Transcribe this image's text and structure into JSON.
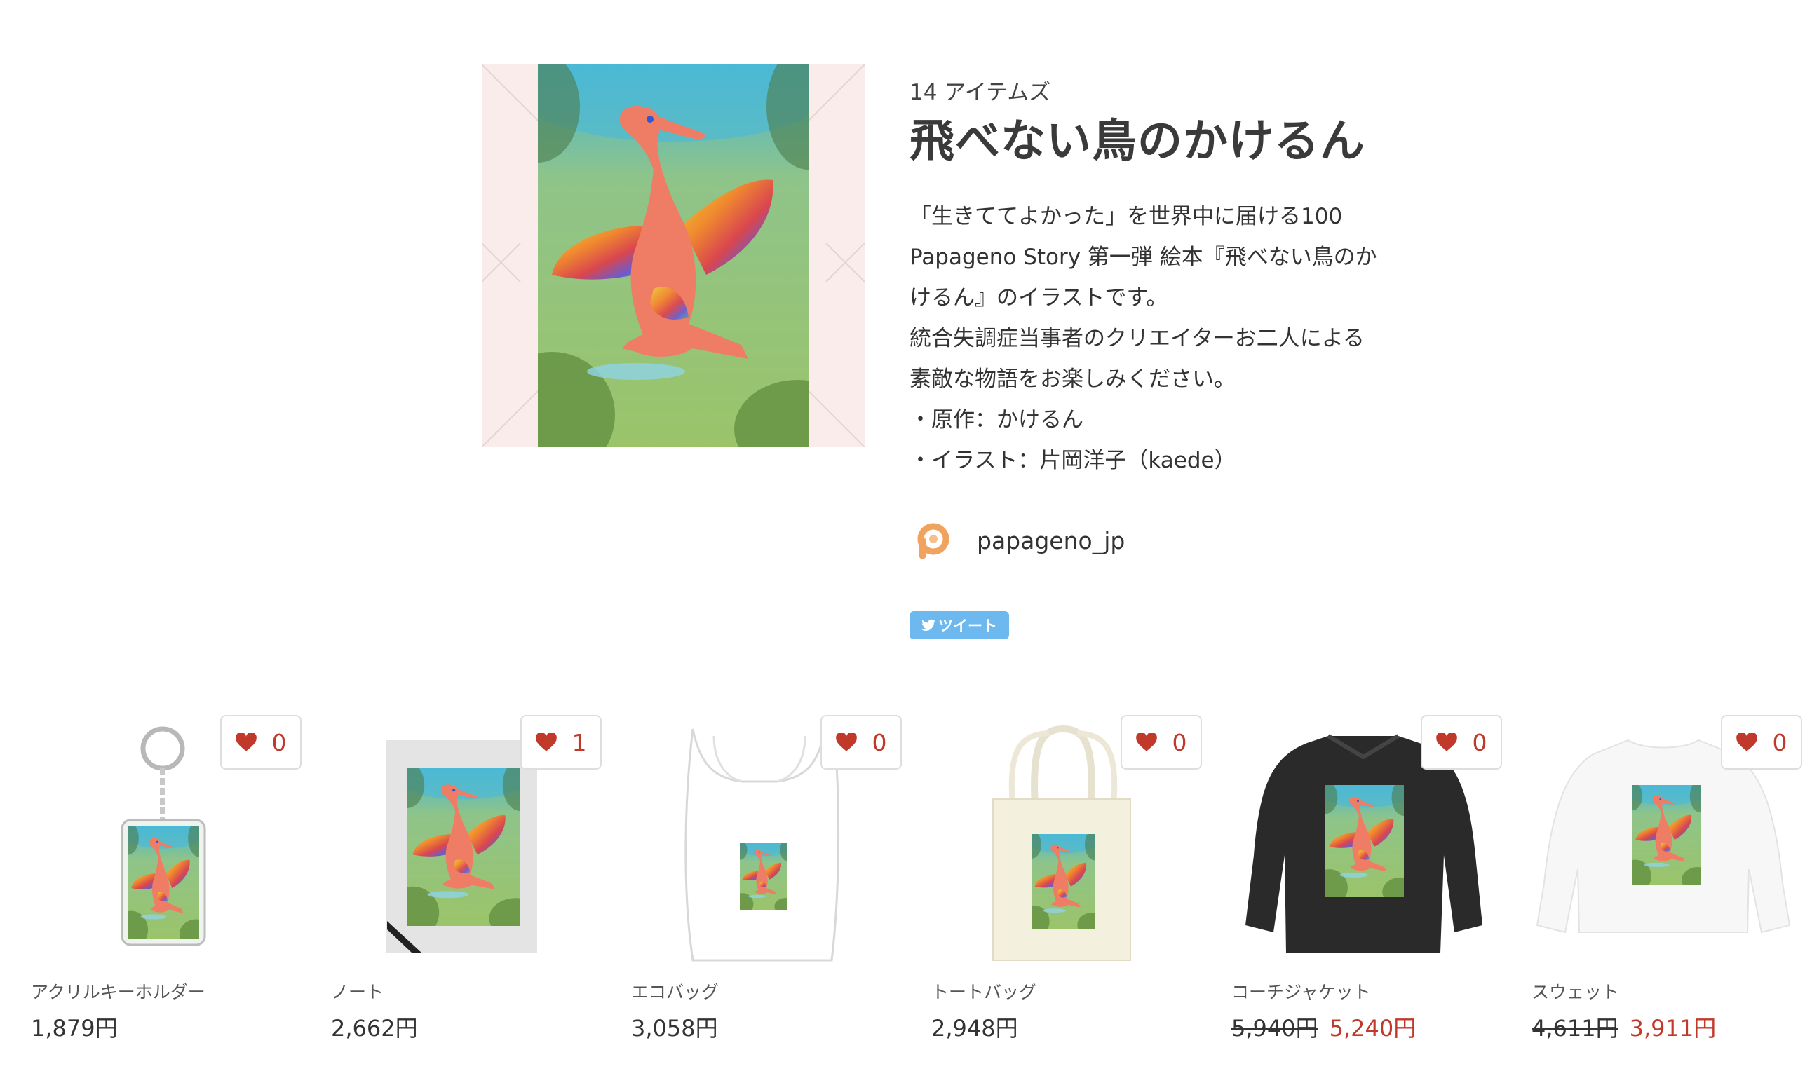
{
  "collection": {
    "item_count": "14 アイテムズ",
    "title": "飛べない鳥のかけるん",
    "description_lines": [
      "「生きててよかった」を世界中に届ける100",
      "Papageno Story 第一弾 絵本『飛べない鳥のか",
      "けるん』のイラストです。",
      "統合失調症当事者のクリエイターお二人による",
      "素敵な物語をお楽しみください。",
      "・原作：かけるん",
      "・イラスト：片岡洋子（kaede）"
    ],
    "creator": "papageno_jp",
    "tweet_label": "ツイート"
  },
  "products": [
    {
      "name": "アクリルキーホルダー",
      "price": "1,879円",
      "likes": "0",
      "icon": "acrylic-keychain"
    },
    {
      "name": "ノート",
      "price": "2,662円",
      "likes": "1",
      "icon": "notebook"
    },
    {
      "name": "エコバッグ",
      "price": "3,058円",
      "likes": "0",
      "icon": "eco-bag"
    },
    {
      "name": "トートバッグ",
      "price": "2,948円",
      "likes": "0",
      "icon": "tote-bag"
    },
    {
      "name": "コーチジャケット",
      "old_price": "5,940円",
      "price": "5,240円",
      "likes": "0",
      "icon": "coach-jacket"
    },
    {
      "name": "スウェット",
      "old_price": "4,611円",
      "price": "3,911円",
      "likes": "0",
      "icon": "sweatshirt"
    }
  ],
  "colors": {
    "accent_red": "#c0392b",
    "tweet_blue": "#55acee",
    "avatar_orange": "#f0a35e"
  }
}
